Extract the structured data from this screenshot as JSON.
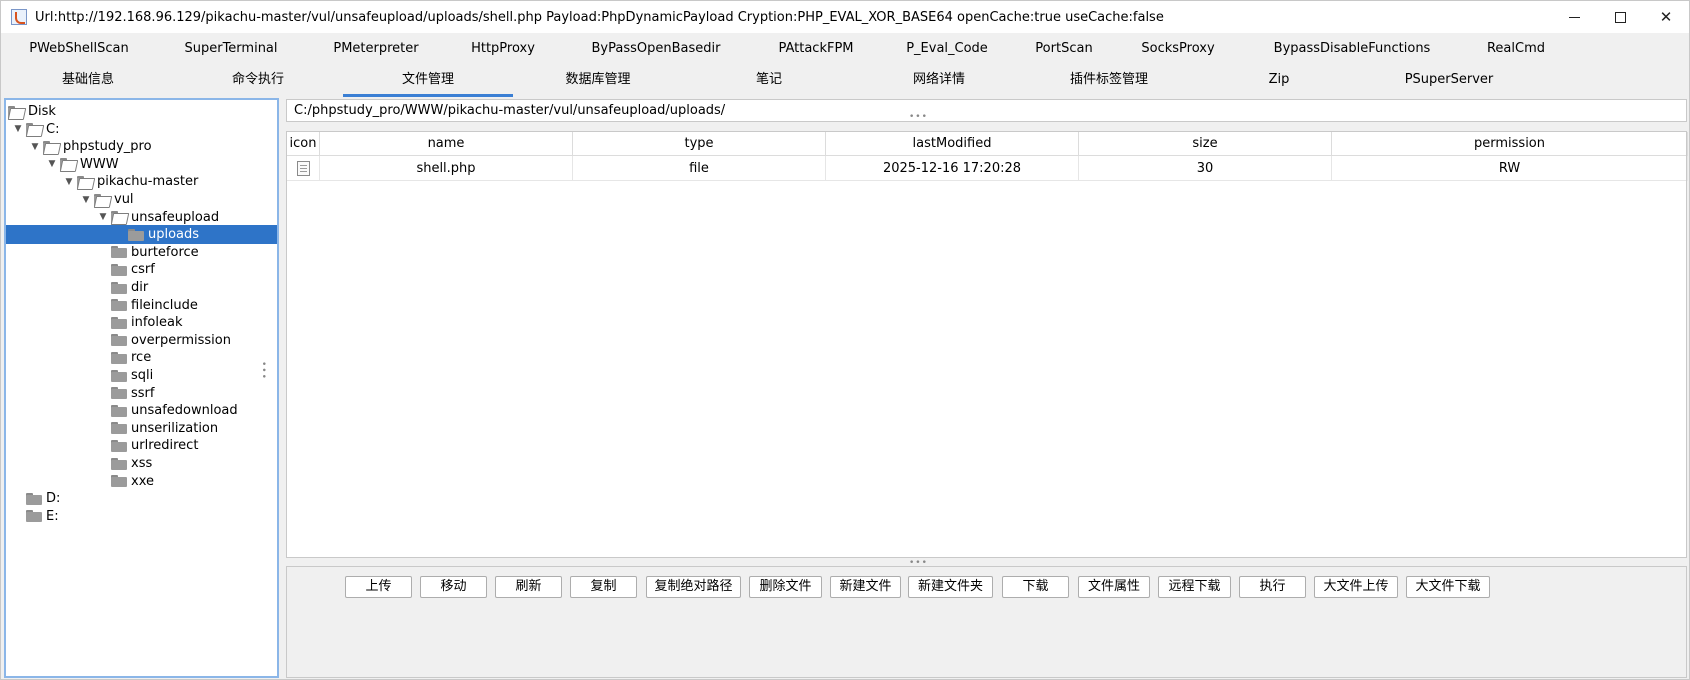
{
  "window": {
    "title": "Url:http://192.168.96.129/pikachu-master/vul/unsafeupload/uploads/shell.php Payload:PhpDynamicPayload Cryption:PHP_EVAL_XOR_BASE64 openCache:true useCache:false",
    "controls": {
      "minimize": "",
      "maximize": "",
      "close": "✕"
    }
  },
  "plugins": [
    "PWebShellScan",
    "SuperTerminal",
    "PMeterpreter",
    "HttpProxy",
    "ByPassOpenBasedir",
    "PAttackFPM",
    "P_Eval_Code",
    "PortScan",
    "SocksProxy",
    "BypassDisableFunctions",
    "RealCmd"
  ],
  "tabs": [
    "基础信息",
    "命令执行",
    "文件管理",
    "数据库管理",
    "笔记",
    "网络详情",
    "插件标签管理",
    "Zip",
    "PSuperServer"
  ],
  "active_tab": "文件管理",
  "tree": {
    "nodes": [
      {
        "label": "Disk",
        "level": 0,
        "toggle": "",
        "icon": "open-folder"
      },
      {
        "label": "C:",
        "level": 1,
        "toggle": "▼",
        "icon": "open-folder"
      },
      {
        "label": "phpstudy_pro",
        "level": 2,
        "toggle": "▼",
        "icon": "open-folder"
      },
      {
        "label": "WWW",
        "level": 3,
        "toggle": "▼",
        "icon": "open-folder"
      },
      {
        "label": "pikachu-master",
        "level": 4,
        "toggle": "▼",
        "icon": "open-folder"
      },
      {
        "label": "vul",
        "level": 5,
        "toggle": "▼",
        "icon": "open-folder"
      },
      {
        "label": "unsafeupload",
        "level": 6,
        "toggle": "▼",
        "icon": "open-folder"
      },
      {
        "label": "uploads",
        "level": 7,
        "toggle": "",
        "icon": "folder",
        "selected": true
      },
      {
        "label": "burteforce",
        "level": 6,
        "toggle": "",
        "icon": "folder"
      },
      {
        "label": "csrf",
        "level": 6,
        "toggle": "",
        "icon": "folder"
      },
      {
        "label": "dir",
        "level": 6,
        "toggle": "",
        "icon": "folder"
      },
      {
        "label": "fileinclude",
        "level": 6,
        "toggle": "",
        "icon": "folder"
      },
      {
        "label": "infoleak",
        "level": 6,
        "toggle": "",
        "icon": "folder"
      },
      {
        "label": "overpermission",
        "level": 6,
        "toggle": "",
        "icon": "folder"
      },
      {
        "label": "rce",
        "level": 6,
        "toggle": "",
        "icon": "folder"
      },
      {
        "label": "sqli",
        "level": 6,
        "toggle": "",
        "icon": "folder"
      },
      {
        "label": "ssrf",
        "level": 6,
        "toggle": "",
        "icon": "folder"
      },
      {
        "label": "unsafedownload",
        "level": 6,
        "toggle": "",
        "icon": "folder"
      },
      {
        "label": "unserilization",
        "level": 6,
        "toggle": "",
        "icon": "folder"
      },
      {
        "label": "urlredirect",
        "level": 6,
        "toggle": "",
        "icon": "folder"
      },
      {
        "label": "xss",
        "level": 6,
        "toggle": "",
        "icon": "folder"
      },
      {
        "label": "xxe",
        "level": 6,
        "toggle": "",
        "icon": "folder"
      },
      {
        "label": "D:",
        "level": 1,
        "toggle": "",
        "icon": "folder"
      },
      {
        "label": "E:",
        "level": 1,
        "toggle": "",
        "icon": "folder"
      }
    ]
  },
  "path": "C:/phpstudy_pro/WWW/pikachu-master/vul/unsafeupload/uploads/",
  "file_table": {
    "columns": [
      "icon",
      "name",
      "type",
      "lastModified",
      "size",
      "permission"
    ],
    "rows": [
      {
        "icon": "file-icon",
        "name": "shell.php",
        "type": "file",
        "lastModified": "2025-12-16 17:20:28",
        "size": "30",
        "permission": "RW"
      }
    ]
  },
  "actions": [
    "上传",
    "移动",
    "刷新",
    "复制",
    "复制绝对路径",
    "删除文件",
    "新建文件",
    "新建文件夹",
    "下载",
    "文件属性",
    "远程下载",
    "执行",
    "大文件上传",
    "大文件下载"
  ],
  "splitter_glyph": "•••",
  "colors": {
    "selection": "#2e74c8",
    "active_tab_underline": "#3b7fd4",
    "tree_border": "#8bb6e8"
  }
}
